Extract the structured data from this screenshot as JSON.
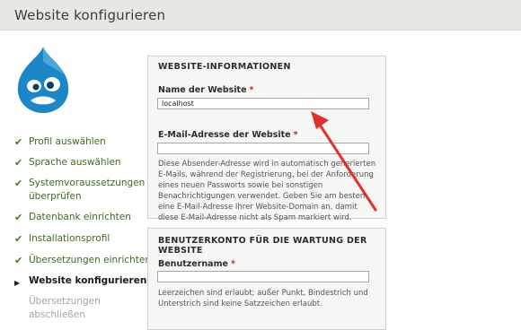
{
  "header": {
    "title": "Website konfigurieren"
  },
  "colors": {
    "checkmark": "#3e7d12",
    "required": "#cc2222",
    "arrow": "#e0322a",
    "logo": "#1b86c8"
  },
  "sidebar": {
    "steps": [
      {
        "label": "Profil auswählen",
        "state": "done"
      },
      {
        "label": "Sprache auswählen",
        "state": "done"
      },
      {
        "label": "Systemvoraussetzungen überprüfen",
        "state": "done"
      },
      {
        "label": "Datenbank einrichten",
        "state": "done"
      },
      {
        "label": "Installationsprofil",
        "state": "done"
      },
      {
        "label": "Übersetzungen einrichten",
        "state": "done"
      },
      {
        "label": "Website konfigurieren",
        "state": "active"
      },
      {
        "label": "Übersetzungen abschließen",
        "state": "pending"
      }
    ],
    "icons": {
      "done": "✔",
      "active": "▶"
    }
  },
  "site_info": {
    "legend": "WEBSITE-INFORMATIONEN",
    "site_name_label": "Name der Website",
    "site_name_value": "localhost",
    "email_label": "E-Mail-Adresse der Website",
    "email_value": "",
    "email_description": "Diese Absender-Adresse wird in automatisch generierten E-Mails, während der Registrierung, bei der Anforderung eines neuen Passworts sowie bei sonstigen Benachrichtigungen verwendet. Geben Sie am besten eine E-Mail-Adresse Ihrer Website-Domain an, damit diese E-Mail-Adresse nicht als Spam markiert wird."
  },
  "admin_account": {
    "legend": "BENUTZERKONTO FÜR DIE WARTUNG DER WEBSITE",
    "username_label": "Benutzername",
    "username_value": "",
    "username_description": "Leerzeichen sind erlaubt; außer Punkt, Bindestrich und Unterstrich sind keine Satzzeichen erlaubt."
  },
  "required_marker": "*"
}
